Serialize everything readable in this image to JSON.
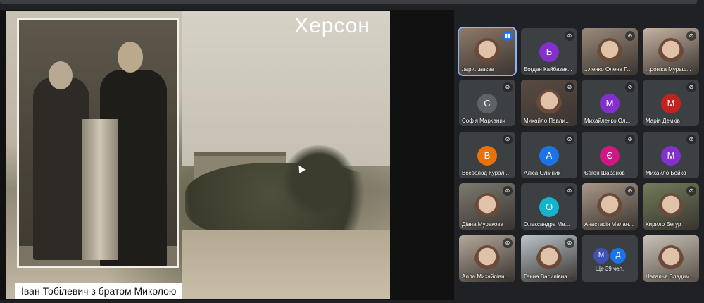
{
  "presentation": {
    "city_title": "Херсон",
    "caption": "Іван Тобілевич з братом Миколою"
  },
  "participants": [
    {
      "name": "лари...ваєва",
      "initial": "",
      "color": "#8e7a6a",
      "video": true,
      "speaking": true,
      "active": true
    },
    {
      "name": "Богдан Кайбазак...",
      "initial": "Б",
      "color": "#8430ce",
      "video": false
    },
    {
      "name": "...ченко Олена Гри...",
      "initial": "",
      "color": "#9b8a7b",
      "video": true
    },
    {
      "name": "...роніка Мураш...",
      "initial": "",
      "color": "#c7b3a3",
      "video": true
    },
    {
      "name": "Софія Марканич",
      "initial": "С",
      "color": "#5f6368",
      "video": false
    },
    {
      "name": "Михайло Павлишин",
      "initial": "",
      "color": "#5a4b44",
      "video": true
    },
    {
      "name": "Михайленко Ол...",
      "initial": "М",
      "color": "#8430ce",
      "video": false
    },
    {
      "name": "Марія Демків",
      "initial": "М",
      "color": "#c5221f",
      "video": false
    },
    {
      "name": "Всеволод Курал...",
      "initial": "В",
      "color": "#e8710a",
      "video": false
    },
    {
      "name": "Аліса Олійник",
      "initial": "А",
      "color": "#1a73e8",
      "video": false
    },
    {
      "name": "Євген Шабанов",
      "initial": "Є",
      "color": "#d01884",
      "video": false
    },
    {
      "name": "Михайло Бойко",
      "initial": "М",
      "color": "#8430ce",
      "video": false
    },
    {
      "name": "Діана Муракова",
      "initial": "",
      "color": "#7d7a70",
      "video": true
    },
    {
      "name": "Олександра Ме...",
      "initial": "О",
      "color": "#12b5cb",
      "video": false
    },
    {
      "name": "Анастасія Малан...",
      "initial": "",
      "color": "#a99888",
      "video": true
    },
    {
      "name": "Кирило Бегур",
      "initial": "",
      "color": "#6f7d5a",
      "video": true
    },
    {
      "name": "Алла Михайлівн...",
      "initial": "",
      "color": "#b5a89a",
      "video": true
    },
    {
      "name": "Ганна Василівна ...",
      "initial": "",
      "color": "#b9c4c8",
      "video": true
    }
  ],
  "more": {
    "initials": [
      "М",
      "Д"
    ],
    "colors": [
      "#3f51b5",
      "#1a73e8"
    ],
    "text": "Ще 39 чел."
  },
  "last_participant": {
    "name": "Наталья Владим...",
    "color": "#c9c0b6"
  }
}
